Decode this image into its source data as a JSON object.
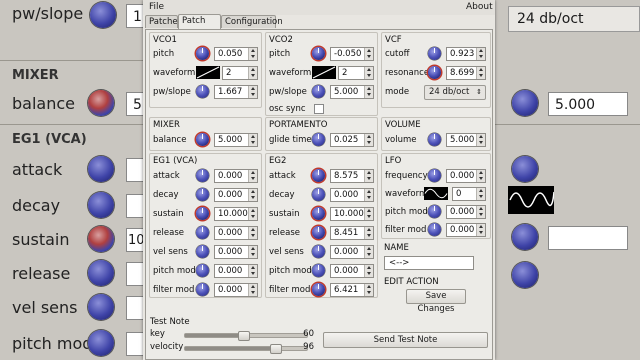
{
  "background": {
    "pw_label": "pw/slope",
    "pw_value": "1.",
    "mixer": "MIXER",
    "balance": "balance",
    "balance_value": "5.",
    "eg1": "EG1 (VCA)",
    "attack": "attack",
    "decay": "decay",
    "sustain": "sustain",
    "sustain_value": "10",
    "release": "release",
    "vel_sens": "vel sens",
    "pitch_mod": "pitch mod",
    "right_combo": "24 db/oct",
    "right_value": "5.000"
  },
  "menu": {
    "file": "File",
    "about": "About"
  },
  "tabs": [
    "Patches",
    "Patch Edit",
    "Configuration"
  ],
  "vco1": {
    "title": "VCO1",
    "pitch_label": "pitch",
    "pitch": "0.050",
    "waveform_label": "waveform",
    "waveform": "2",
    "pw_label": "pw/slope",
    "pw": "1.667"
  },
  "vco2": {
    "title": "VCO2",
    "pitch_label": "pitch",
    "pitch": "-0.050",
    "waveform_label": "waveform",
    "waveform": "2",
    "pw_label": "pw/slope",
    "pw": "5.000",
    "sync_label": "osc sync"
  },
  "vcf": {
    "title": "VCF",
    "cutoff_label": "cutoff",
    "cutoff": "0.923",
    "resonance_label": "resonance",
    "resonance": "8.699",
    "mode_label": "mode",
    "mode": "24 db/oct"
  },
  "mixer": {
    "title": "MIXER",
    "balance_label": "balance",
    "balance": "5.000"
  },
  "portamento": {
    "title": "PORTAMENTO",
    "glide_label": "glide time",
    "glide": "0.025"
  },
  "volume": {
    "title": "VOLUME",
    "volume_label": "volume",
    "volume": "5.000"
  },
  "eg1": {
    "title": "EG1 (VCA)",
    "rows": [
      {
        "label": "attack",
        "value": "0.000"
      },
      {
        "label": "decay",
        "value": "0.000"
      },
      {
        "label": "sustain",
        "value": "10.000"
      },
      {
        "label": "release",
        "value": "0.000"
      },
      {
        "label": "vel sens",
        "value": "0.000"
      },
      {
        "label": "pitch mod",
        "value": "0.000"
      },
      {
        "label": "filter mod",
        "value": "0.000"
      }
    ]
  },
  "eg2": {
    "title": "EG2",
    "rows": [
      {
        "label": "attack",
        "value": "8.575"
      },
      {
        "label": "decay",
        "value": "0.000"
      },
      {
        "label": "sustain",
        "value": "10.000"
      },
      {
        "label": "release",
        "value": "8.451"
      },
      {
        "label": "vel sens",
        "value": "0.000"
      },
      {
        "label": "pitch mod",
        "value": "0.000"
      },
      {
        "label": "filter mod",
        "value": "6.421"
      }
    ]
  },
  "lfo": {
    "title": "LFO",
    "frequency_label": "frequency",
    "frequency": "0.000",
    "waveform_label": "waveform",
    "waveform": "0",
    "pitch_label": "pitch mod",
    "pitch": "0.000",
    "filter_label": "filter mod",
    "filter": "0.000"
  },
  "name": {
    "title": "NAME",
    "value": "<-->"
  },
  "edit_action": {
    "title": "EDIT ACTION",
    "save_label": "Save Changes"
  },
  "test_note": {
    "title": "Test Note",
    "key_label": "key",
    "key": "60",
    "key_fraction": 0.47,
    "velocity_label": "velocity",
    "velocity": "96",
    "velocity_fraction": 0.76,
    "send_label": "Send Test Note"
  }
}
